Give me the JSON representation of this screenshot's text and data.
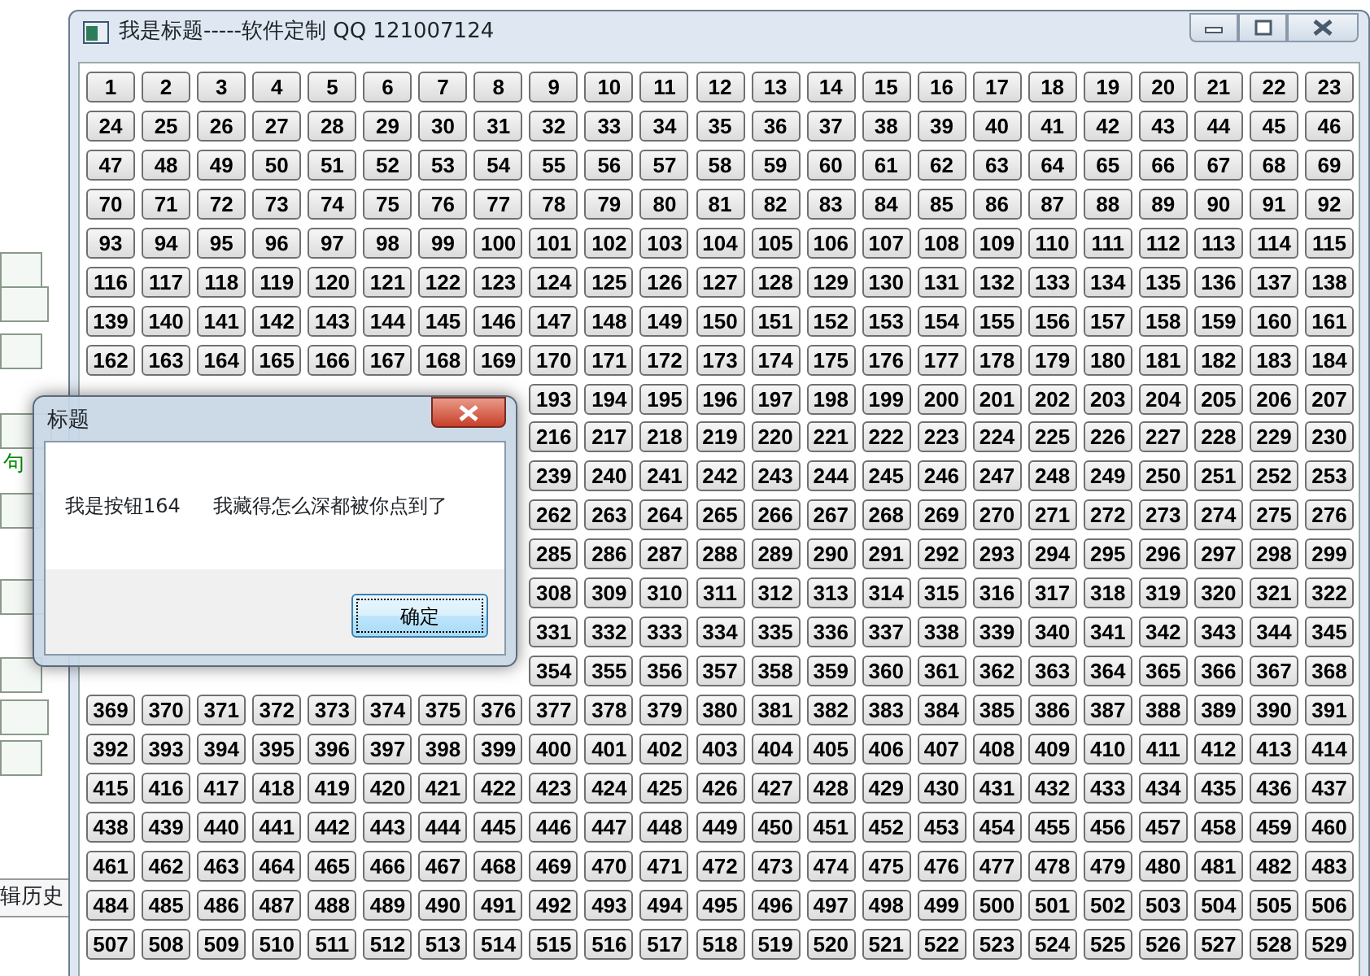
{
  "background_window": {
    "label": "句",
    "tab": "辑历史"
  },
  "window": {
    "title": "我是标题-----软件定制 QQ 121007124",
    "button_rows": [
      [
        "1",
        "2",
        "3",
        "4",
        "5",
        "6",
        "7",
        "8",
        "9",
        "10",
        "11",
        "12",
        "13",
        "14",
        "15",
        "16",
        "17",
        "18",
        "19",
        "20",
        "21",
        "22",
        "23"
      ],
      [
        "24",
        "25",
        "26",
        "27",
        "28",
        "29",
        "30",
        "31",
        "32",
        "33",
        "34",
        "35",
        "36",
        "37",
        "38",
        "39",
        "40",
        "41",
        "42",
        "43",
        "44",
        "45",
        "46"
      ],
      [
        "47",
        "48",
        "49",
        "50",
        "51",
        "52",
        "53",
        "54",
        "55",
        "56",
        "57",
        "58",
        "59",
        "60",
        "61",
        "62",
        "63",
        "64",
        "65",
        "66",
        "67",
        "68",
        "69"
      ],
      [
        "70",
        "71",
        "72",
        "73",
        "74",
        "75",
        "76",
        "77",
        "78",
        "79",
        "80",
        "81",
        "82",
        "83",
        "84",
        "85",
        "86",
        "87",
        "88",
        "89",
        "90",
        "91",
        "92"
      ],
      [
        "93",
        "94",
        "95",
        "96",
        "97",
        "98",
        "99",
        "100",
        "101",
        "102",
        "103",
        "104",
        "105",
        "106",
        "107",
        "108",
        "109",
        "110",
        "111",
        "112",
        "113",
        "114",
        "115"
      ],
      [
        "116",
        "117",
        "118",
        "119",
        "120",
        "121",
        "122",
        "123",
        "124",
        "125",
        "126",
        "127",
        "128",
        "129",
        "130",
        "131",
        "132",
        "133",
        "134",
        "135",
        "136",
        "137",
        "138"
      ],
      [
        "139",
        "140",
        "141",
        "142",
        "143",
        "144",
        "145",
        "146",
        "147",
        "148",
        "149",
        "150",
        "151",
        "152",
        "153",
        "154",
        "155",
        "156",
        "157",
        "158",
        "159",
        "160",
        "161"
      ],
      [
        "162",
        "163",
        "164",
        "165",
        "166",
        "167",
        "168",
        "169",
        "170",
        "171",
        "172",
        "173",
        "174",
        "175",
        "176",
        "177",
        "178",
        "179",
        "180",
        "181",
        "182",
        "183",
        "184"
      ],
      [
        "193",
        "194",
        "195",
        "196",
        "197",
        "198",
        "199",
        "200",
        "201",
        "202",
        "203",
        "204",
        "205",
        "206",
        "207"
      ],
      [
        "216",
        "217",
        "218",
        "219",
        "220",
        "221",
        "222",
        "223",
        "224",
        "225",
        "226",
        "227",
        "228",
        "229",
        "230"
      ],
      [
        "239",
        "240",
        "241",
        "242",
        "243",
        "244",
        "245",
        "246",
        "247",
        "248",
        "249",
        "250",
        "251",
        "252",
        "253"
      ],
      [
        "262",
        "263",
        "264",
        "265",
        "266",
        "267",
        "268",
        "269",
        "270",
        "271",
        "272",
        "273",
        "274",
        "275",
        "276"
      ],
      [
        "285",
        "286",
        "287",
        "288",
        "289",
        "290",
        "291",
        "292",
        "293",
        "294",
        "295",
        "296",
        "297",
        "298",
        "299"
      ],
      [
        "308",
        "309",
        "310",
        "311",
        "312",
        "313",
        "314",
        "315",
        "316",
        "317",
        "318",
        "319",
        "320",
        "321",
        "322"
      ],
      [
        "331",
        "332",
        "333",
        "334",
        "335",
        "336",
        "337",
        "338",
        "339",
        "340",
        "341",
        "342",
        "343",
        "344",
        "345"
      ],
      [
        "354",
        "355",
        "356",
        "357",
        "358",
        "359",
        "360",
        "361",
        "362",
        "363",
        "364",
        "365",
        "366",
        "367",
        "368"
      ],
      [
        "369",
        "370",
        "371",
        "372",
        "373",
        "374",
        "375",
        "376",
        "377",
        "378",
        "379",
        "380",
        "381",
        "382",
        "383",
        "384",
        "385",
        "386",
        "387",
        "388",
        "389",
        "390",
        "391"
      ],
      [
        "392",
        "393",
        "394",
        "395",
        "396",
        "397",
        "398",
        "399",
        "400",
        "401",
        "402",
        "403",
        "404",
        "405",
        "406",
        "407",
        "408",
        "409",
        "410",
        "411",
        "412",
        "413",
        "414"
      ],
      [
        "415",
        "416",
        "417",
        "418",
        "419",
        "420",
        "421",
        "422",
        "423",
        "424",
        "425",
        "426",
        "427",
        "428",
        "429",
        "430",
        "431",
        "432",
        "433",
        "434",
        "435",
        "436",
        "437"
      ],
      [
        "438",
        "439",
        "440",
        "441",
        "442",
        "443",
        "444",
        "445",
        "446",
        "447",
        "448",
        "449",
        "450",
        "451",
        "452",
        "453",
        "454",
        "455",
        "456",
        "457",
        "458",
        "459",
        "460"
      ],
      [
        "461",
        "462",
        "463",
        "464",
        "465",
        "466",
        "467",
        "468",
        "469",
        "470",
        "471",
        "472",
        "473",
        "474",
        "475",
        "476",
        "477",
        "478",
        "479",
        "480",
        "481",
        "482",
        "483"
      ],
      [
        "484",
        "485",
        "486",
        "487",
        "488",
        "489",
        "490",
        "491",
        "492",
        "493",
        "494",
        "495",
        "496",
        "497",
        "498",
        "499",
        "500",
        "501",
        "502",
        "503",
        "504",
        "505",
        "506"
      ],
      [
        "507",
        "508",
        "509",
        "510",
        "511",
        "512",
        "513",
        "514",
        "515",
        "516",
        "517",
        "518",
        "519",
        "520",
        "521",
        "522",
        "523",
        "524",
        "525",
        "526",
        "527",
        "528",
        "529"
      ]
    ]
  },
  "dialog": {
    "title": "标题",
    "message_parts": [
      "我是按钮164",
      "我藏得怎么深都被你点到了"
    ],
    "ok_button": "确定"
  }
}
